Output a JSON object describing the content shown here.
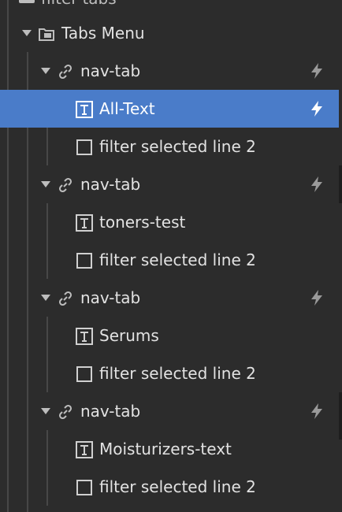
{
  "colors": {
    "background": "#2c2c2c",
    "selection": "#4a7cc9",
    "text": "#e2e2e2",
    "icon": "#bdbdbd",
    "guide": "#474747"
  },
  "tree": {
    "parent_partial_label": "filter-tabs",
    "tabs_menu": {
      "label": "Tabs Menu",
      "icon": "folder-icon"
    },
    "nav_tabs": [
      {
        "label": "nav-tab",
        "icon": "link-icon",
        "children": [
          {
            "label": "All-Text",
            "icon": "text-icon",
            "selected": true
          },
          {
            "label": "filter selected line 2",
            "icon": "box-icon"
          }
        ]
      },
      {
        "label": "nav-tab",
        "icon": "link-icon",
        "children": [
          {
            "label": "toners-test",
            "icon": "text-icon"
          },
          {
            "label": "filter selected line 2",
            "icon": "box-icon"
          }
        ]
      },
      {
        "label": "nav-tab",
        "icon": "link-icon",
        "children": [
          {
            "label": "Serums",
            "icon": "text-icon"
          },
          {
            "label": "filter selected line 2",
            "icon": "box-icon"
          }
        ]
      },
      {
        "label": "nav-tab",
        "icon": "link-icon",
        "children": [
          {
            "label": "Moisturizers-text",
            "icon": "text-icon"
          },
          {
            "label": "filter selected line 2",
            "icon": "box-icon"
          }
        ]
      }
    ]
  }
}
